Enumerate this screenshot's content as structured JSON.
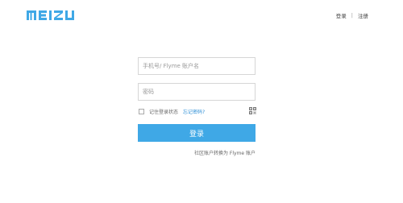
{
  "brand": {
    "logo_text": "MEIZU",
    "accent": "#3fa8e6",
    "link_color": "#2d8fd6"
  },
  "topnav": {
    "login": "登录",
    "separator": "|",
    "register": "注册"
  },
  "form": {
    "account_placeholder": "手机号/ Flyme 账户名",
    "password_placeholder": "密码",
    "remember_label": "记住登录状态",
    "forgot_label": "忘记密码?",
    "qr_icon": "qr-code-icon",
    "submit_label": "登录",
    "convert_label": "社区账户转换为 Flyme 账户"
  }
}
